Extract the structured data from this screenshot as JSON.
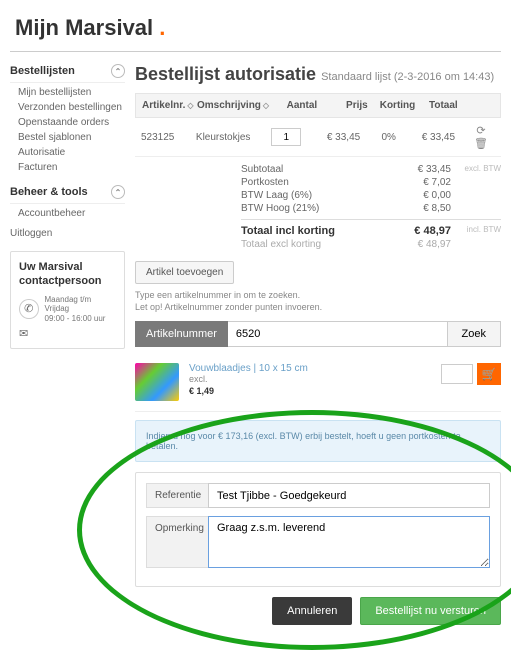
{
  "page": {
    "title": "Mijn Marsival",
    "dot": "."
  },
  "sidebar": {
    "section1": {
      "title": "Bestellijsten",
      "items": [
        "Mijn bestellijsten",
        "Verzonden bestellingen",
        "Openstaande orders",
        "Bestel sjablonen",
        "Autorisatie",
        "Facturen"
      ]
    },
    "section2": {
      "title": "Beheer & tools",
      "items": [
        "Accountbeheer"
      ]
    },
    "logout": "Uitloggen",
    "contact": {
      "title1": "Uw Marsival",
      "title2": "contactpersoon",
      "hours": "Maandag t/m Vrijdag\n09:00 - 16:00 uur"
    }
  },
  "content": {
    "heading": "Bestellijst autorisatie",
    "sub": "Standaard lijst (2-3-2016 om 14:43)"
  },
  "table": {
    "headers": {
      "art": "Artikelnr.",
      "desc": "Omschrijving",
      "qty": "Aantal",
      "price": "Prijs",
      "disc": "Korting",
      "total": "Totaal"
    },
    "rows": [
      {
        "art": "523125",
        "desc": "Kleurstokjes",
        "qty": "1",
        "price": "€ 33,45",
        "disc": "0%",
        "total": "€ 33,45"
      }
    ]
  },
  "totals": {
    "subtotal_l": "Subtotaal",
    "subtotal_v": "€ 33,45",
    "excl": "excl. BTW",
    "ship_l": "Portkosten",
    "ship_v": "€ 7,02",
    "btw1_l": "BTW Laag (6%)",
    "btw1_v": "€ 0,00",
    "btw2_l": "BTW Hoog (21%)",
    "btw2_v": "€ 8,50",
    "grand_l": "Totaal incl korting",
    "grand_v": "€ 48,97",
    "incl": "incl. BTW",
    "excl_l": "Totaal excl korting",
    "excl_v": "€ 48,97"
  },
  "buttons": {
    "add_article": "Artikel toevoegen",
    "search_label": "Artikelnummer",
    "search_value": "6520",
    "search_btn": "Zoek",
    "cancel": "Annuleren",
    "submit": "Bestellijst nu versturen"
  },
  "hints": {
    "l1": "Type een artikelnummer in om te zoeken.",
    "l2": "Let op! Artikelnummer zonder punten invoeren."
  },
  "product": {
    "name": "Vouwblaadjes | 10 x 15 cm",
    "meta": "excl.",
    "price": "€ 1,49"
  },
  "notice": "Indien u nog voor € 173,16 (excl. BTW) erbij bestelt, hoeft u geen portkosten te betalen.",
  "form": {
    "ref_label": "Referentie",
    "ref_value": "Test Tjibbe - Goedgekeurd",
    "rem_label": "Opmerking",
    "rem_value": "Graag z.s.m. leverend"
  }
}
